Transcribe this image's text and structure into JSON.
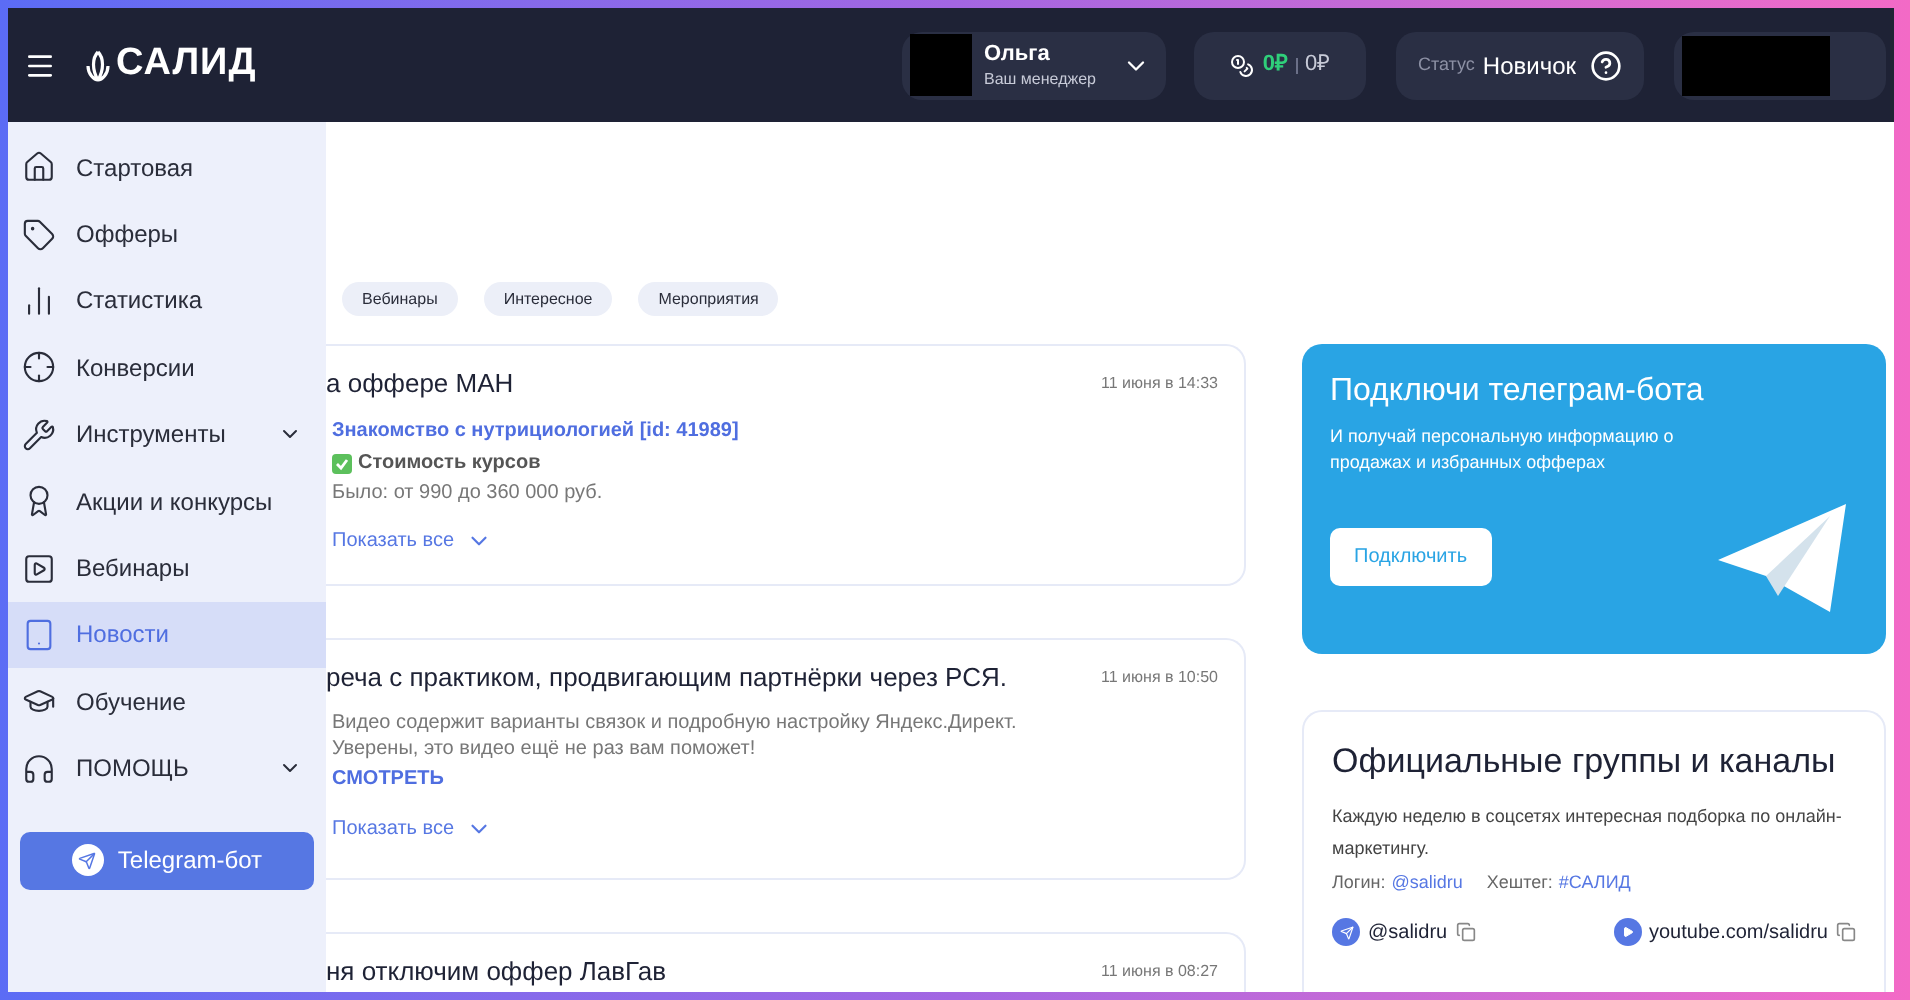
{
  "header": {
    "logo": "САЛИД",
    "manager": {
      "name": "Ольга",
      "role": "Ваш менеджер"
    },
    "balance": {
      "available": "0₽",
      "held": "0₽"
    },
    "status": {
      "label": "Статус",
      "value": "Новичок"
    }
  },
  "sidebar": {
    "items": [
      {
        "label": "Стартовая",
        "selected": false,
        "expandable": false
      },
      {
        "label": "Офферы",
        "selected": false,
        "expandable": false
      },
      {
        "label": "Статистика",
        "selected": false,
        "expandable": false
      },
      {
        "label": "Конверсии",
        "selected": false,
        "expandable": false
      },
      {
        "label": "Инструменты",
        "selected": false,
        "expandable": true
      },
      {
        "label": "Акции и конкурсы",
        "selected": false,
        "expandable": false
      },
      {
        "label": "Вебинары",
        "selected": false,
        "expandable": false
      },
      {
        "label": "Новости",
        "selected": true,
        "expandable": false
      },
      {
        "label": "Обучение",
        "selected": false,
        "expandable": false
      },
      {
        "label": "ПОМОЩЬ",
        "selected": false,
        "expandable": true
      }
    ],
    "telegram_button": "Telegram-бот"
  },
  "filters": [
    {
      "label": "Вебинары",
      "selected": false
    },
    {
      "label": "Интересное",
      "selected": false
    },
    {
      "label": "Мероприятия",
      "selected": false
    }
  ],
  "news": [
    {
      "title": "а оффере МАН",
      "date": "11 июня в 14:33",
      "body": [
        {
          "kind": "offer_link",
          "text": "Знакомство с нутрициологией [id: 41989]"
        },
        {
          "kind": "checked",
          "text": "Стоимость курсов"
        },
        {
          "kind": "text",
          "text": "Было: от 990 до 360 000 руб."
        }
      ],
      "show_all": "Показать все"
    },
    {
      "title": "реча с практиком, продвигающим партнёрки через РСЯ.",
      "date": "11 июня в 10:50",
      "body": [
        {
          "kind": "text",
          "text": "Видео содержит варианты связок и подробную настройку Яндекс.Директ. Уверены, это видео ещё не раз вам поможет!"
        },
        {
          "kind": "action_link",
          "text": "СМОТРЕТЬ"
        }
      ],
      "show_all": "Показать все"
    },
    {
      "title": "ня отключим оффер ЛавГав",
      "date": "11 июня в 08:27"
    }
  ],
  "promo": {
    "title": "Подключи телеграм-бота",
    "text": "И получай персональную информацию о продажах и избранных офферах",
    "button": "Подключить"
  },
  "groups": {
    "title": "Официальные группы и каналы",
    "text": "Каждую неделю в соцсетях интересная подборка по онлайн-маркетингу.",
    "login_label": "Логин:",
    "login": "@salidru",
    "hashtag_label": "Хештег:",
    "hashtag": "#САЛИД",
    "channels": [
      {
        "kind": "telegram",
        "label": "@salidru"
      },
      {
        "kind": "youtube",
        "label": "youtube.com/salidru"
      }
    ]
  }
}
